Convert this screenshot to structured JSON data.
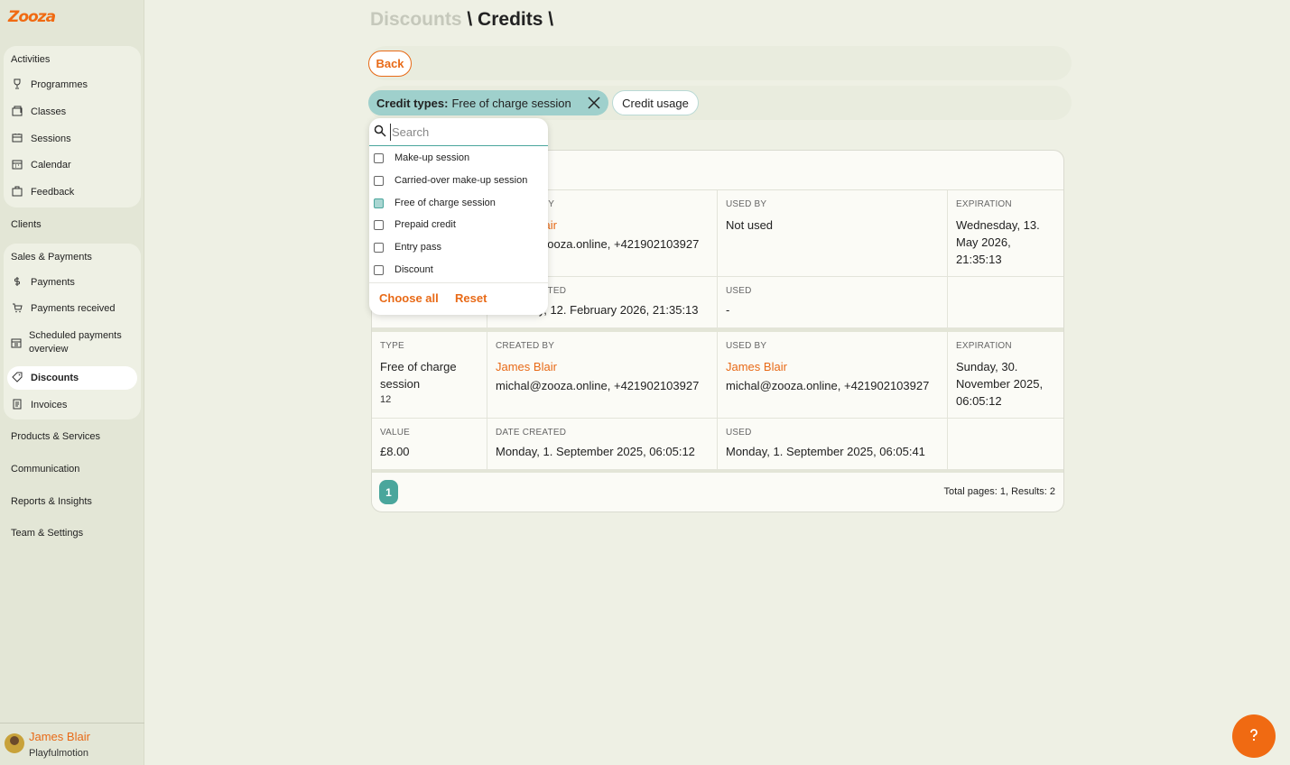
{
  "brand": {
    "logo_text": "Zooza",
    "accent": "#e86a17",
    "teal": "#4aa69c"
  },
  "sidebar": {
    "activities": {
      "title": "Activities",
      "items": [
        {
          "label": "Programmes",
          "icon": "trophy-icon"
        },
        {
          "label": "Classes",
          "icon": "folder-icon"
        },
        {
          "label": "Sessions",
          "icon": "session-icon"
        },
        {
          "label": "Calendar",
          "icon": "calendar-icon"
        },
        {
          "label": "Feedback",
          "icon": "feedback-icon"
        }
      ]
    },
    "clients": "Clients",
    "sales": {
      "title": "Sales & Payments",
      "items": [
        {
          "label": "Payments",
          "icon": "coin-icon"
        },
        {
          "label": "Payments received",
          "icon": "cart-icon"
        },
        {
          "label": "Scheduled payments overview",
          "icon": "schedule-icon"
        },
        {
          "label": "Discounts",
          "icon": "tag-icon"
        },
        {
          "label": "Invoices",
          "icon": "invoice-icon"
        }
      ]
    },
    "products": "Products & Services",
    "communication": "Communication",
    "reports": "Reports & Insights",
    "team": "Team & Settings",
    "user": {
      "name": "James Blair",
      "org": "Playfulmotion"
    }
  },
  "breadcrumb": {
    "parent": "Discounts",
    "sep1": "\\",
    "current": "Credits",
    "sep2": "\\"
  },
  "back_label": "Back",
  "filters": {
    "credit_types_label": "Credit types:",
    "credit_types_value": "Free of charge session",
    "credit_usage_label": "Credit usage"
  },
  "dropdown": {
    "search_placeholder": "Search",
    "options": [
      {
        "label": "Make-up session",
        "checked": false
      },
      {
        "label": "Carried-over make-up session",
        "checked": false
      },
      {
        "label": "Free of charge session",
        "checked": true
      },
      {
        "label": "Prepaid credit",
        "checked": false
      },
      {
        "label": "Entry pass",
        "checked": false
      },
      {
        "label": "Discount",
        "checked": false
      }
    ],
    "choose_all": "Choose all",
    "reset": "Reset"
  },
  "table": {
    "rows": [
      {
        "created_by_caption": "CREATED BY",
        "created_by_name": "James Blair",
        "created_by_contact": "michal@zooza.online, +421902103927",
        "used_by_caption": "USED BY",
        "used_by_value": "Not used",
        "expiration_caption": "EXPIRATION",
        "expiration_value": "Wednesday, 13. May 2026, 21:35:13",
        "date_created_caption": "DATE CREATED",
        "date_created_value": "Thursday, 12. February 2026, 21:35:13",
        "used_caption": "USED",
        "used_value": "-"
      },
      {
        "type_caption": "TYPE",
        "type_value": "Free of charge session",
        "type_id": "12",
        "created_by_caption": "CREATED BY",
        "created_by_name": "James Blair",
        "created_by_contact": "michal@zooza.online, +421902103927",
        "used_by_caption": "USED BY",
        "used_by_name": "James Blair",
        "used_by_contact": "michal@zooza.online, +421902103927",
        "expiration_caption": "EXPIRATION",
        "expiration_value": "Sunday, 30. November 2025, 06:05:12",
        "value_caption": "VALUE",
        "value_value": "£8.00",
        "date_created_caption": "DATE CREATED",
        "date_created_value": "Monday, 1. September 2025, 06:05:12",
        "used_caption": "USED",
        "used_value": "Monday, 1. September 2025, 06:05:41"
      }
    ],
    "page": "1",
    "total": "Total pages: 1, Results: 2"
  },
  "help_icon": "help-icon"
}
